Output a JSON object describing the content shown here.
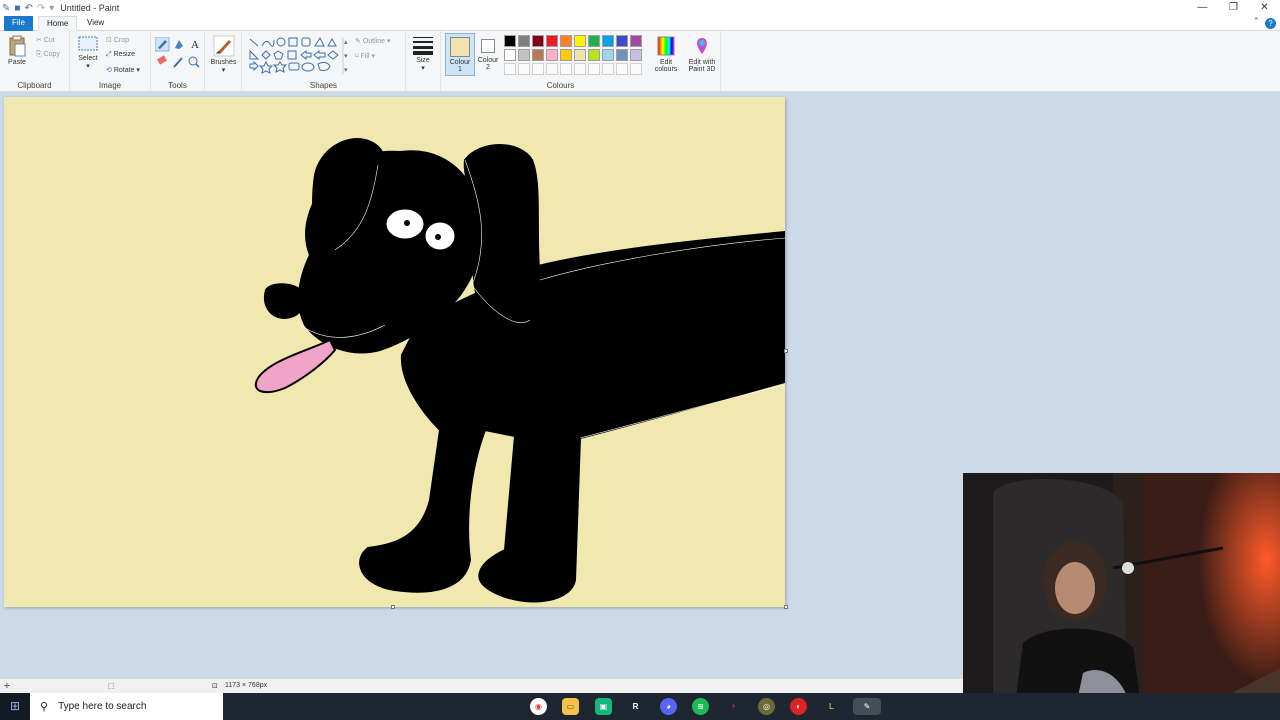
{
  "window": {
    "title": "Untitled - Paint",
    "controls": [
      "minimize",
      "restore",
      "close"
    ]
  },
  "menu": {
    "tabs": [
      "File",
      "Home",
      "View"
    ]
  },
  "ribbon": {
    "clipboard": {
      "label": "Clipboard",
      "paste": "Paste",
      "cut": "Cut",
      "copy": "Copy"
    },
    "image": {
      "label": "Image",
      "select": "Select",
      "crop": "Crop",
      "resize": "Resize",
      "rotate": "Rotate"
    },
    "tools": {
      "label": "Tools"
    },
    "brushes": {
      "label": "Brushes"
    },
    "shapes": {
      "label": "Shapes",
      "outline": "Outline",
      "fill": "Fill"
    },
    "size": {
      "label": "Size"
    },
    "colours": {
      "label": "Colours",
      "colour1": "Colour",
      "colour1_num": "1",
      "colour2": "Colour",
      "colour2_num": "2",
      "edit": "Edit",
      "edit2": "colours",
      "paint3d": "Edit with",
      "paint3d2": "Paint 3D",
      "colour1_value": "#efe4b0",
      "colour2_value": "#ffffff",
      "palette_row1": [
        "#000000",
        "#7f7f7f",
        "#880015",
        "#ed1c24",
        "#ff7f27",
        "#fff200",
        "#22b14c",
        "#00a2e8",
        "#3f48cc",
        "#a349a4"
      ],
      "palette_row2": [
        "#ffffff",
        "#c3c3c3",
        "#b97a57",
        "#ffaec9",
        "#ffc90e",
        "#efe4b0",
        "#b5e61d",
        "#99d9ea",
        "#7092be",
        "#c8bfe7"
      ]
    }
  },
  "statusbar": {
    "dimensions": "1173 × 768px"
  },
  "taskbar": {
    "search_placeholder": "Type here to search",
    "apps": [
      "chrome",
      "file-explorer",
      "app-green",
      "rockstar",
      "discord",
      "spotify",
      "app-red",
      "app-circle",
      "app-red2",
      "app-league",
      "paint"
    ]
  }
}
